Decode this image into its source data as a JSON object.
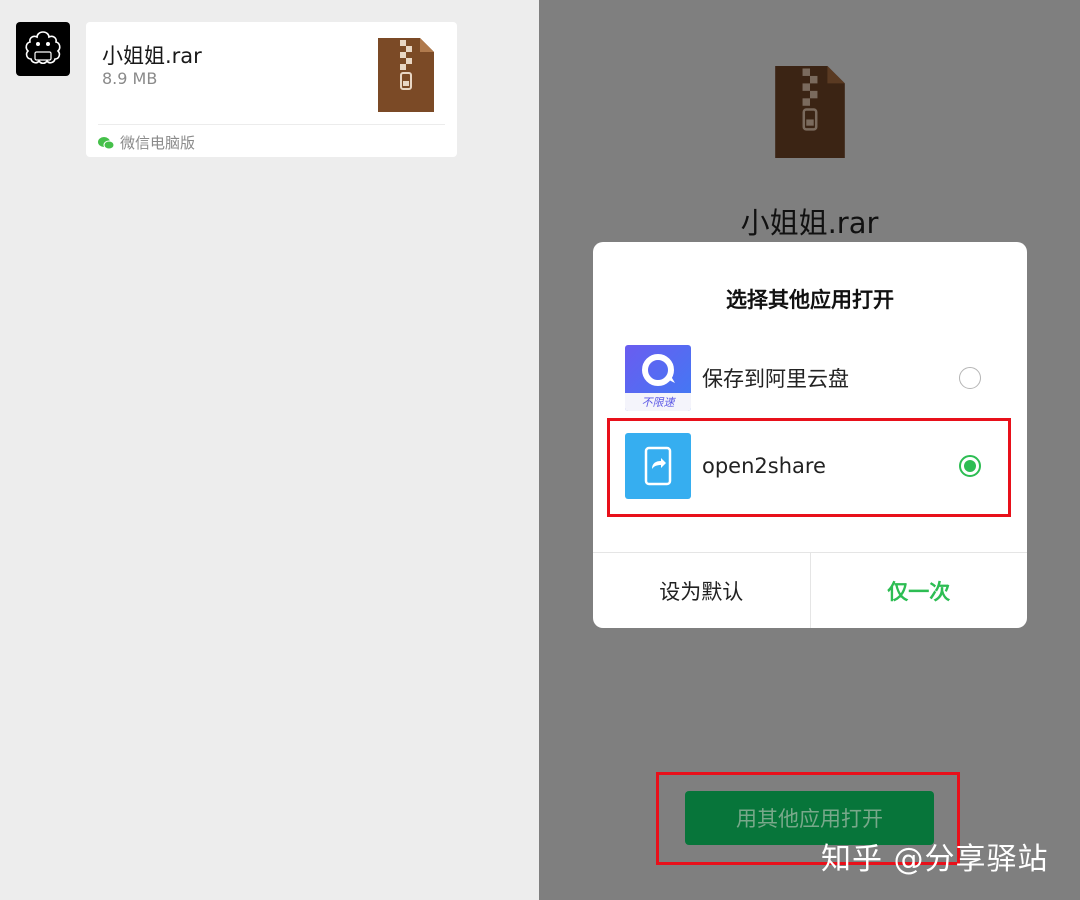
{
  "chat": {
    "file_name": "小姐姐.rar",
    "file_size": "8.9 MB",
    "source": "微信电脑版",
    "avatar_icon": "profile-avatar-icon",
    "file_icon": "zip-archive-icon"
  },
  "preview": {
    "file_name": "小姐姐.rar",
    "file_icon": "zip-archive-icon"
  },
  "dialog": {
    "title": "选择其他应用打开",
    "options": [
      {
        "label": "保存到阿里云盘",
        "icon": "aliyun-drive-icon",
        "icon_caption": "不限速",
        "selected": false
      },
      {
        "label": "open2share",
        "icon": "open2share-icon",
        "selected": true
      }
    ],
    "actions": {
      "set_default": "设为默认",
      "just_once": "仅一次"
    }
  },
  "open_button": "用其他应用打开",
  "watermark": "知乎 @分享驿站",
  "colors": {
    "accent_green": "#2dbd53",
    "button_green": "#07753a",
    "highlight_red": "#e8101a",
    "zip_brown": "#7b4a26"
  }
}
